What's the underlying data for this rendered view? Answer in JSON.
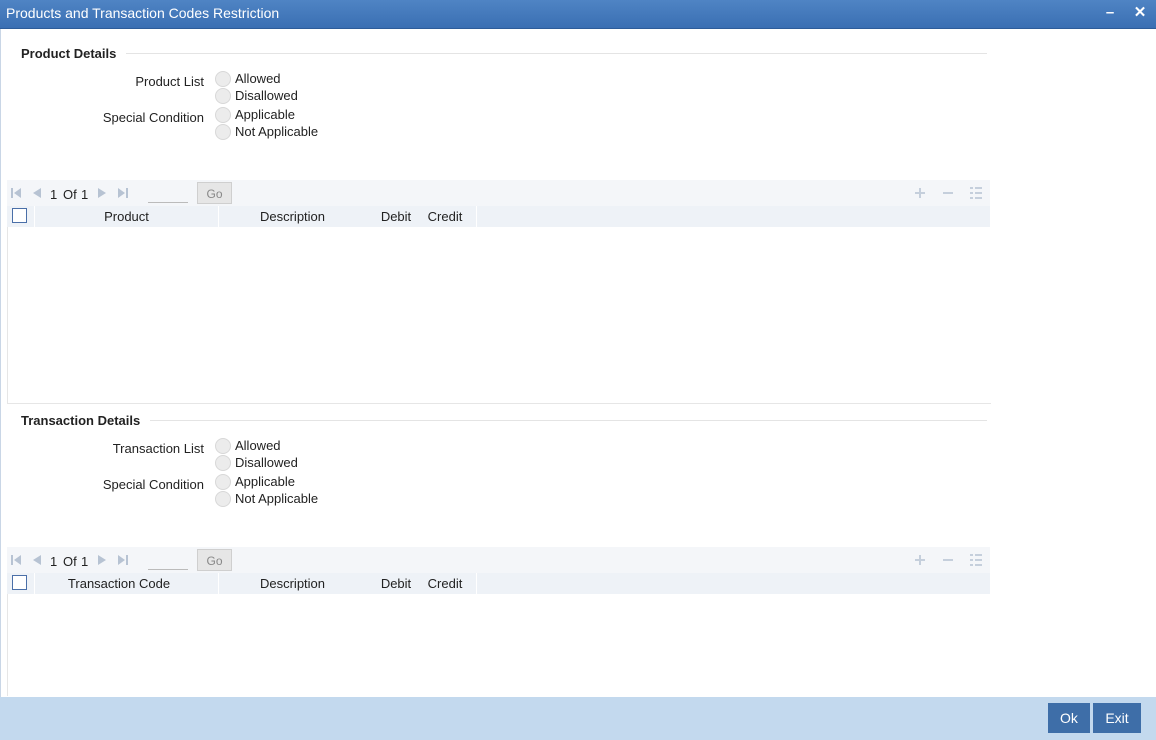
{
  "window": {
    "title": "Products and Transaction Codes Restriction"
  },
  "product": {
    "section_title": "Product Details",
    "list_label": "Product List",
    "list_options": [
      "Allowed",
      "Disallowed"
    ],
    "special_label": "Special Condition",
    "special_options": [
      "Applicable",
      "Not Applicable"
    ],
    "pager": {
      "current": "1",
      "of_label": "Of",
      "total": "1",
      "go_label": "Go"
    },
    "columns": [
      "Product",
      "Description",
      "Debit",
      "Credit"
    ]
  },
  "transaction": {
    "section_title": "Transaction Details",
    "list_label": "Transaction List",
    "list_options": [
      "Allowed",
      "Disallowed"
    ],
    "special_label": "Special Condition",
    "special_options": [
      "Applicable",
      "Not Applicable"
    ],
    "pager": {
      "current": "1",
      "of_label": "Of",
      "total": "1",
      "go_label": "Go"
    },
    "columns": [
      "Transaction Code",
      "Description",
      "Debit",
      "Credit"
    ]
  },
  "footer": {
    "ok_label": "Ok",
    "exit_label": "Exit"
  }
}
